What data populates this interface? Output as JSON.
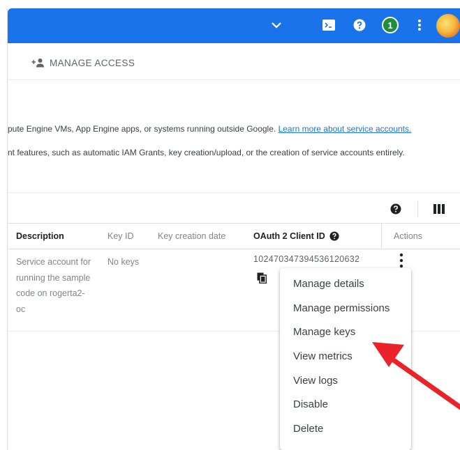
{
  "toolbar": {
    "manage_access_label": "MANAGE ACCESS",
    "notification_count": "1"
  },
  "info": {
    "line1_text": "pute Engine VMs, App Engine apps, or systems running outside Google. ",
    "line1_link": "Learn more about service accounts.",
    "line2_text": "nt features, such as automatic IAM Grants, key creation/upload, or the creation of service accounts entirely."
  },
  "table": {
    "columns": [
      "Description",
      "Key ID",
      "Key creation date",
      "OAuth 2 Client ID",
      "Actions"
    ],
    "row": {
      "description": "Service account for running the sample code on rogerta2-oc",
      "key_id": "No keys",
      "key_creation_date": "",
      "oauth_client_id": "102470347394536120632"
    }
  },
  "menu": {
    "items": [
      "Manage details",
      "Manage permissions",
      "Manage keys",
      "View metrics",
      "View logs",
      "Disable",
      "Delete"
    ]
  },
  "colors": {
    "topbar": "#1a73e8",
    "link": "#1a73e8",
    "arrow": "#e8232a"
  }
}
